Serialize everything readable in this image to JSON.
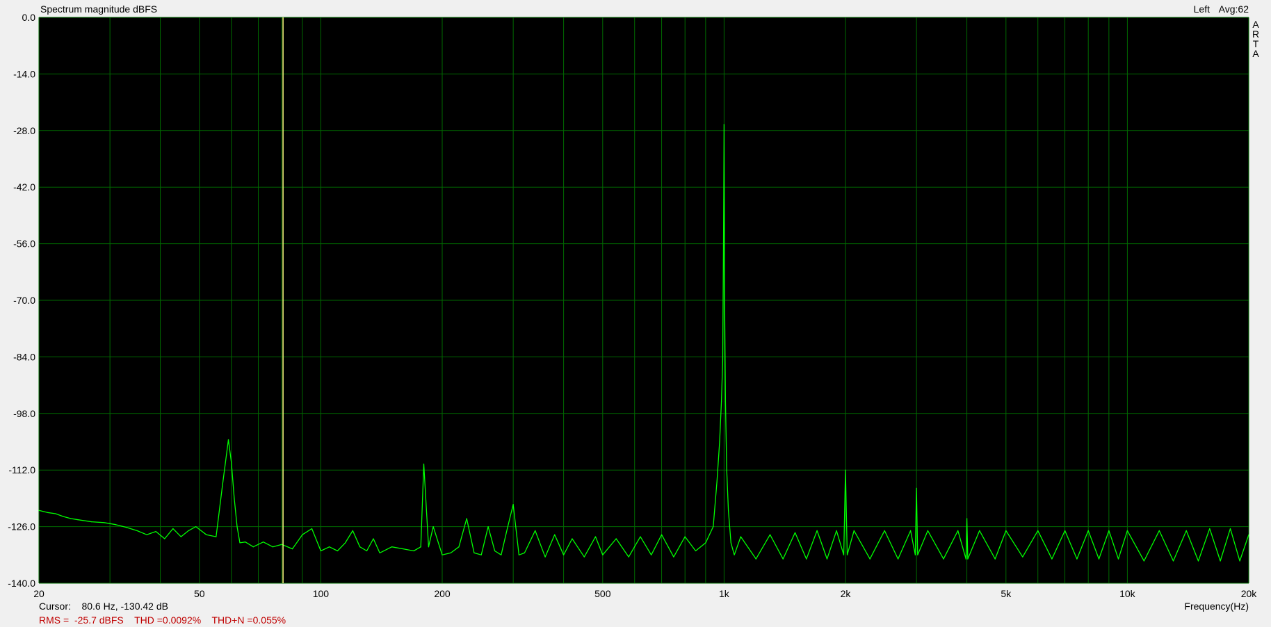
{
  "chart_data": {
    "type": "line",
    "title": "Spectrum magnitude dBFS",
    "channel": "Left",
    "avg": "Avg:62",
    "side_label": [
      "A",
      "R",
      "T",
      "A"
    ],
    "xlabel": "Frequency(Hz)",
    "ylabel": "",
    "x_scale": "log",
    "xlim": [
      20,
      20000
    ],
    "ylim": [
      -140,
      0
    ],
    "grid": true,
    "x_tick_labels": [
      {
        "v": 20,
        "t": "20"
      },
      {
        "v": 50,
        "t": "50"
      },
      {
        "v": 100,
        "t": "100"
      },
      {
        "v": 200,
        "t": "200"
      },
      {
        "v": 500,
        "t": "500"
      },
      {
        "v": 1000,
        "t": "1k"
      },
      {
        "v": 2000,
        "t": "2k"
      },
      {
        "v": 5000,
        "t": "5k"
      },
      {
        "v": 10000,
        "t": "10k"
      },
      {
        "v": 20000,
        "t": "20k"
      }
    ],
    "y_tick_labels": [
      {
        "v": 0,
        "t": "0.0"
      },
      {
        "v": -14,
        "t": "-14.0"
      },
      {
        "v": -28,
        "t": "-28.0"
      },
      {
        "v": -42,
        "t": "-42.0"
      },
      {
        "v": -56,
        "t": "-56.0"
      },
      {
        "v": -70,
        "t": "-70.0"
      },
      {
        "v": -84,
        "t": "-84.0"
      },
      {
        "v": -98,
        "t": "-98.0"
      },
      {
        "v": -112,
        "t": "-112.0"
      },
      {
        "v": -126,
        "t": "-126.0"
      },
      {
        "v": -140,
        "t": "-140.0"
      }
    ],
    "cursor_freq": 80.6,
    "cursor_text": "Cursor:    80.6 Hz, -130.42 dB",
    "stats_text": "RMS =  -25.7 dBFS    THD =0.0092%    THD+N =0.055%",
    "colors": {
      "background": "#000000",
      "grid": "#006a00",
      "trace": "#00ff00",
      "cursor": "#ffff80",
      "stats": "#c00000"
    },
    "series": [
      {
        "x": [
          20,
          21,
          22,
          23,
          24,
          25,
          27,
          29,
          31,
          33,
          35,
          37,
          39,
          41,
          43,
          45,
          47,
          49,
          52,
          55,
          57,
          59,
          60,
          61,
          62,
          63,
          65,
          68,
          72,
          76,
          80,
          85,
          90,
          95,
          100,
          105,
          110,
          115,
          120,
          125,
          130,
          135,
          140,
          150,
          160,
          170,
          177,
          180,
          185,
          190,
          200,
          210,
          220,
          230,
          240,
          250,
          260,
          270,
          280,
          290,
          300,
          310,
          320,
          340,
          360,
          380,
          400,
          420,
          450,
          480,
          500,
          540,
          580,
          620,
          660,
          700,
          750,
          800,
          850,
          900,
          940,
          960,
          975,
          985,
          992,
          996,
          998,
          1000,
          1002,
          1004,
          1008,
          1015,
          1025,
          1040,
          1060,
          1100,
          1200,
          1300,
          1400,
          1500,
          1600,
          1700,
          1800,
          1900,
          1980,
          2000,
          2020,
          2100,
          2300,
          2500,
          2700,
          2900,
          2980,
          3000,
          3020,
          3200,
          3500,
          3800,
          3980,
          4000,
          4020,
          4300,
          4700,
          5000,
          5500,
          6000,
          6500,
          7000,
          7500,
          8000,
          8500,
          9000,
          9500,
          10000,
          11000,
          12000,
          13000,
          14000,
          15000,
          16000,
          17000,
          18000,
          19000,
          20000
        ],
        "y": [
          -122,
          -122.5,
          -122.8,
          -123.5,
          -124,
          -124.3,
          -124.8,
          -125,
          -125.5,
          -126.2,
          -127,
          -128,
          -127.2,
          -129,
          -126.5,
          -128.5,
          -127,
          -126,
          -128,
          -128.5,
          -116,
          -104.5,
          -110,
          -119,
          -126,
          -130,
          -129.8,
          -131,
          -129.8,
          -131,
          -130.4,
          -131.5,
          -128,
          -126.5,
          -132,
          -131,
          -132,
          -130,
          -127,
          -131,
          -132,
          -129,
          -132.5,
          -131,
          -131.5,
          -132,
          -131,
          -110.5,
          -131,
          -126,
          -133,
          -132.5,
          -131,
          -124,
          -132.5,
          -133,
          -126,
          -132,
          -133,
          -126.5,
          -120.5,
          -133,
          -132.5,
          -127,
          -133.5,
          -128,
          -133,
          -129,
          -133.5,
          -128.5,
          -133,
          -129,
          -133.5,
          -128.5,
          -133,
          -128,
          -133.5,
          -128.5,
          -132,
          -130,
          -126,
          -115,
          -105,
          -95,
          -85,
          -60,
          -45,
          -26.5,
          -50,
          -75,
          -95,
          -112,
          -122,
          -130,
          -133,
          -128.5,
          -134,
          -128,
          -134,
          -127.5,
          -134,
          -127,
          -134,
          -127,
          -133,
          -112,
          -133,
          -127,
          -134,
          -127,
          -134,
          -127,
          -133,
          -116.5,
          -133,
          -127,
          -134,
          -127,
          -134,
          -124,
          -134,
          -127,
          -134,
          -127,
          -133.5,
          -127,
          -134,
          -127,
          -134,
          -127,
          -134,
          -127,
          -134,
          -127,
          -134.5,
          -127,
          -134.5,
          -127,
          -134.5,
          -126.5,
          -134.5,
          -126.5,
          -134.5,
          -128
        ]
      }
    ]
  }
}
